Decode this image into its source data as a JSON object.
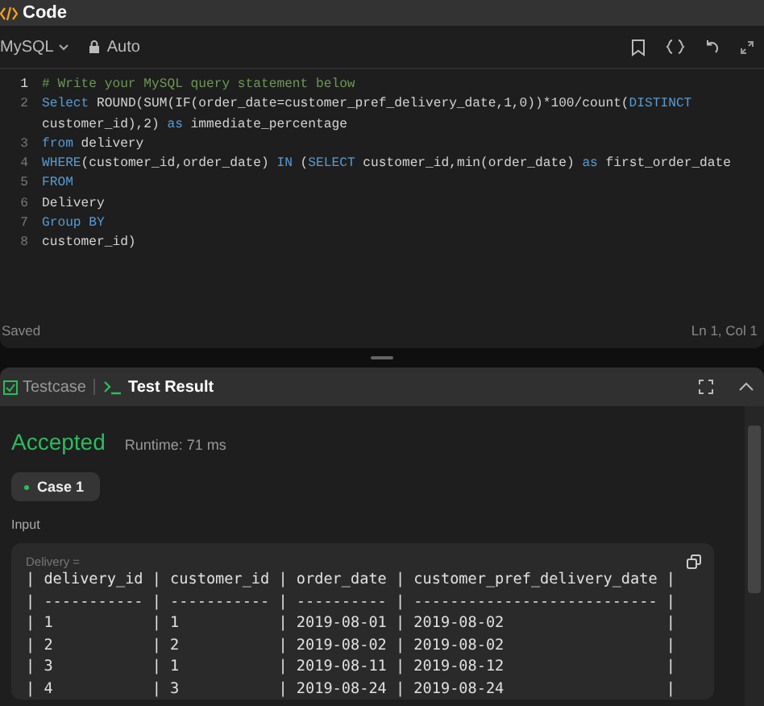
{
  "panel_title": "Code",
  "toolbar": {
    "language": "MySQL",
    "mode": "Auto"
  },
  "code_lines": [
    {
      "number": "1",
      "tokens": [
        {
          "kind": "comment",
          "text": "# Write your MySQL query statement below"
        }
      ]
    },
    {
      "number": "2",
      "tokens": [
        {
          "kind": "keyword",
          "text": "Select"
        },
        {
          "kind": "plain",
          "text": " ROUND(SUM(IF(order_date=customer_pref_delivery_date,1,0))*100/count("
        },
        {
          "kind": "keyword",
          "text": "DISTINCT"
        },
        {
          "kind": "plain",
          "text": " customer_id),2) "
        },
        {
          "kind": "keyword",
          "text": "as"
        },
        {
          "kind": "plain",
          "text": " immediate_percentage"
        }
      ]
    },
    {
      "number": "3",
      "tokens": [
        {
          "kind": "keyword",
          "text": "from"
        },
        {
          "kind": "plain",
          "text": " delivery"
        }
      ]
    },
    {
      "number": "4",
      "tokens": [
        {
          "kind": "keyword",
          "text": "WHERE"
        },
        {
          "kind": "plain",
          "text": "(customer_id,order_date) "
        },
        {
          "kind": "keyword",
          "text": "IN"
        },
        {
          "kind": "plain",
          "text": " ("
        },
        {
          "kind": "keyword",
          "text": "SELECT"
        },
        {
          "kind": "plain",
          "text": " customer_id,min(order_date) "
        },
        {
          "kind": "keyword",
          "text": "as"
        },
        {
          "kind": "plain",
          "text": " first_order_date"
        }
      ]
    },
    {
      "number": "5",
      "tokens": [
        {
          "kind": "keyword",
          "text": "FROM"
        }
      ]
    },
    {
      "number": "6",
      "tokens": [
        {
          "kind": "plain",
          "text": "Delivery"
        }
      ]
    },
    {
      "number": "7",
      "tokens": [
        {
          "kind": "keyword",
          "text": "Group BY"
        }
      ]
    },
    {
      "number": "8",
      "tokens": [
        {
          "kind": "plain",
          "text": "customer_id)"
        }
      ]
    }
  ],
  "editor_status": {
    "left": "Saved",
    "right": "Ln 1, Col 1"
  },
  "result_tabs": [
    {
      "label": "Testcase",
      "kind": "testcase",
      "selected": false
    },
    {
      "label": "Test Result",
      "kind": "result",
      "selected": true
    }
  ],
  "result": {
    "status": "Accepted",
    "runtime": "Runtime: 71 ms"
  },
  "cases": [
    {
      "label": "Case 1",
      "selected": true
    }
  ],
  "input_label": "Input",
  "input_box": {
    "title": "Delivery =",
    "lines": [
      "| delivery_id | customer_id | order_date | customer_pref_delivery_date |",
      "| ----------- | ----------- | ---------- | --------------------------- |",
      "| 1           | 1           | 2019-08-01 | 2019-08-02                  |",
      "| 2           | 2           | 2019-08-02 | 2019-08-02                  |",
      "| 3           | 1           | 2019-08-11 | 2019-08-12                  |",
      "| 4           | 3           | 2019-08-24 | 2019-08-24                  |"
    ]
  }
}
